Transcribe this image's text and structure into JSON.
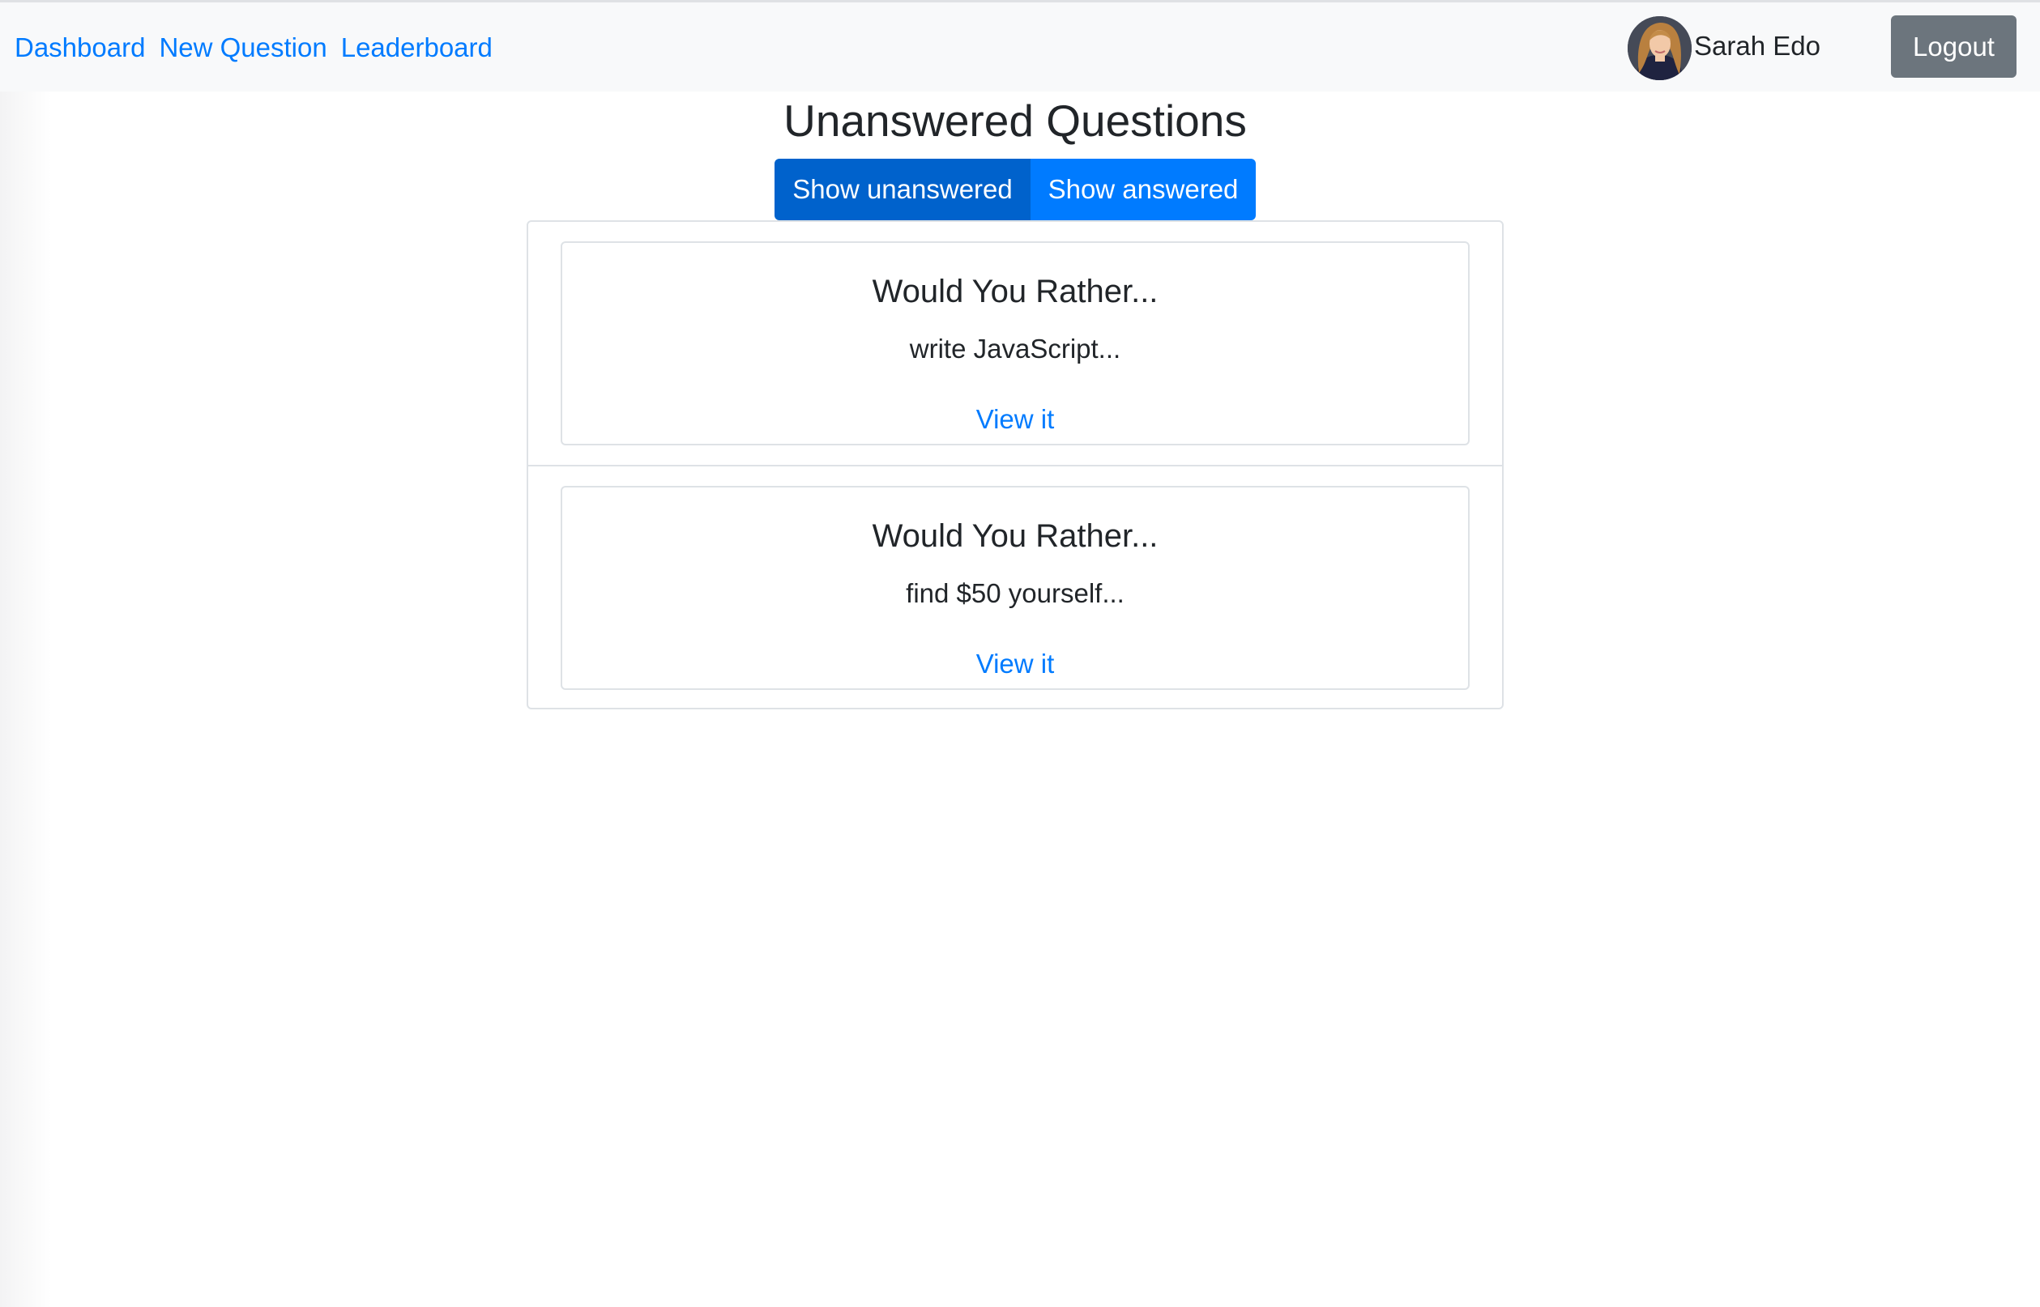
{
  "nav": {
    "links": [
      {
        "label": "Dashboard"
      },
      {
        "label": "New Question"
      },
      {
        "label": "Leaderboard"
      }
    ]
  },
  "user": {
    "name": "Sarah Edo",
    "avatar": "user-avatar-photo"
  },
  "header": {
    "logout_label": "Logout"
  },
  "main": {
    "title": "Unanswered Questions",
    "toggle": {
      "unanswered_label": "Show unanswered",
      "answered_label": "Show answered",
      "selected": "unanswered"
    },
    "questions": [
      {
        "title": "Would You Rather...",
        "option_preview": "write JavaScript...",
        "link_label": "View it"
      },
      {
        "title": "Would You Rather...",
        "option_preview": "find $50 yourself...",
        "link_label": "View it"
      }
    ]
  },
  "colors": {
    "link": "#007bff",
    "active_toggle": "#0062cc",
    "inactive_toggle": "#007bff",
    "logout_button": "#6c757d",
    "navbar_bg": "#f8f9fa"
  }
}
